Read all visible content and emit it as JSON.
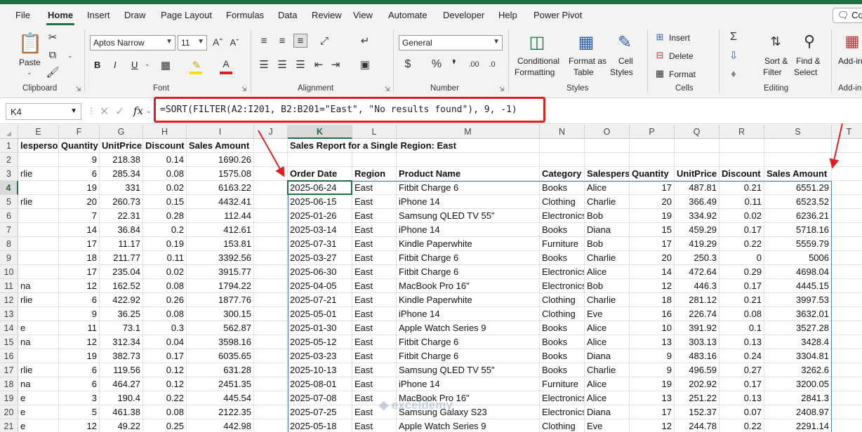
{
  "tabs": [
    "File",
    "Home",
    "Insert",
    "Draw",
    "Page Layout",
    "Formulas",
    "Data",
    "Review",
    "View",
    "Automate",
    "Developer",
    "Help",
    "Power Pivot"
  ],
  "active_tab": "Home",
  "comments_label": "Con",
  "ribbon": {
    "clipboard": {
      "label": "Clipboard",
      "paste": "Paste"
    },
    "font": {
      "label": "Font",
      "name": "Aptos Narrow",
      "size": "11",
      "bold": "B",
      "italic": "I",
      "underline": "U"
    },
    "alignment": {
      "label": "Alignment"
    },
    "number": {
      "label": "Number",
      "format": "General"
    },
    "styles": {
      "label": "Styles",
      "conditional": [
        "Conditional",
        "Formatting"
      ],
      "format_table": [
        "Format as",
        "Table"
      ],
      "cell_styles": [
        "Cell",
        "Styles"
      ]
    },
    "cells": {
      "label": "Cells",
      "insert": "Insert",
      "delete": "Delete",
      "format": "Format"
    },
    "editing": {
      "label": "Editing",
      "sort": [
        "Sort &",
        "Filter"
      ],
      "find": [
        "Find &",
        "Select"
      ]
    },
    "addins": {
      "label": "Add-in",
      "label2": "Add-ins"
    }
  },
  "formula_bar": {
    "name_box": "K4",
    "fx": "fx",
    "formula": "=SORT(FILTER(A2:I201, B2:B201=\"East\", \"No results found\"), 9, -1)"
  },
  "grid": {
    "columns": [
      "E",
      "F",
      "G",
      "H",
      "I",
      "J",
      "K",
      "L",
      "M",
      "N",
      "O",
      "P",
      "Q",
      "R",
      "S",
      "T"
    ],
    "selected_column": "K",
    "rows": [
      "1",
      "2",
      "3",
      "4",
      "5",
      "6",
      "7",
      "8",
      "9",
      "10",
      "11",
      "12",
      "13",
      "14",
      "15",
      "16",
      "17",
      "18",
      "19",
      "20",
      "21"
    ],
    "selected_row": "4",
    "left_headers": [
      "lesperson",
      "Quantity",
      "UnitPrice",
      "Discount",
      "Sales Amount"
    ],
    "left_rows": [
      [
        "",
        "9",
        "218.38",
        "0.14",
        "1690.26"
      ],
      [
        "rlie",
        "6",
        "285.34",
        "0.08",
        "1575.08"
      ],
      [
        "",
        "19",
        "331",
        "0.02",
        "6163.22"
      ],
      [
        "rlie",
        "20",
        "260.73",
        "0.15",
        "4432.41"
      ],
      [
        "",
        "7",
        "22.31",
        "0.28",
        "112.44"
      ],
      [
        "",
        "14",
        "36.84",
        "0.2",
        "412.61"
      ],
      [
        "",
        "17",
        "11.17",
        "0.19",
        "153.81"
      ],
      [
        "",
        "18",
        "211.77",
        "0.11",
        "3392.56"
      ],
      [
        "",
        "17",
        "235.04",
        "0.02",
        "3915.77"
      ],
      [
        "na",
        "12",
        "162.52",
        "0.08",
        "1794.22"
      ],
      [
        "rlie",
        "6",
        "422.92",
        "0.26",
        "1877.76"
      ],
      [
        "",
        "9",
        "36.25",
        "0.08",
        "300.15"
      ],
      [
        "e",
        "11",
        "73.1",
        "0.3",
        "562.87"
      ],
      [
        "na",
        "12",
        "312.34",
        "0.04",
        "3598.16"
      ],
      [
        "",
        "19",
        "382.73",
        "0.17",
        "6035.65"
      ],
      [
        "rlie",
        "6",
        "119.56",
        "0.12",
        "631.28"
      ],
      [
        "na",
        "6",
        "464.27",
        "0.12",
        "2451.35"
      ],
      [
        "e",
        "3",
        "190.4",
        "0.22",
        "445.54"
      ],
      [
        "e",
        "5",
        "461.38",
        "0.08",
        "2122.35"
      ],
      [
        "e",
        "12",
        "49.22",
        "0.25",
        "442.98"
      ]
    ],
    "report_title": "Sales Report for a Single Region: East",
    "report_headers": [
      "Order Date",
      "Region",
      "Product Name",
      "Category",
      "Salesperson",
      "Quantity",
      "UnitPrice",
      "Discount",
      "Sales Amount"
    ],
    "report_rows": [
      [
        "2025-06-24",
        "East",
        "Fitbit Charge 6",
        "Books",
        "Alice",
        "17",
        "487.81",
        "0.21",
        "6551.29"
      ],
      [
        "2025-06-15",
        "East",
        "iPhone 14",
        "Clothing",
        "Charlie",
        "20",
        "366.49",
        "0.11",
        "6523.52"
      ],
      [
        "2025-01-26",
        "East",
        "Samsung QLED TV 55\"",
        "Electronics",
        "Bob",
        "19",
        "334.92",
        "0.02",
        "6236.21"
      ],
      [
        "2025-03-14",
        "East",
        "iPhone 14",
        "Books",
        "Diana",
        "15",
        "459.29",
        "0.17",
        "5718.16"
      ],
      [
        "2025-07-31",
        "East",
        "Kindle Paperwhite",
        "Furniture",
        "Bob",
        "17",
        "419.29",
        "0.22",
        "5559.79"
      ],
      [
        "2025-03-27",
        "East",
        "Fitbit Charge 6",
        "Books",
        "Charlie",
        "20",
        "250.3",
        "0",
        "5006"
      ],
      [
        "2025-06-30",
        "East",
        "Fitbit Charge 6",
        "Electronics",
        "Alice",
        "14",
        "472.64",
        "0.29",
        "4698.04"
      ],
      [
        "2025-04-05",
        "East",
        "MacBook Pro 16\"",
        "Electronics",
        "Bob",
        "12",
        "446.3",
        "0.17",
        "4445.15"
      ],
      [
        "2025-07-21",
        "East",
        "Kindle Paperwhite",
        "Clothing",
        "Charlie",
        "18",
        "281.12",
        "0.21",
        "3997.53"
      ],
      [
        "2025-05-01",
        "East",
        "iPhone 14",
        "Clothing",
        "Eve",
        "16",
        "226.74",
        "0.08",
        "3632.01"
      ],
      [
        "2025-01-30",
        "East",
        "Apple Watch Series 9",
        "Books",
        "Alice",
        "10",
        "391.92",
        "0.1",
        "3527.28"
      ],
      [
        "2025-05-12",
        "East",
        "Fitbit Charge 6",
        "Books",
        "Alice",
        "13",
        "303.13",
        "0.13",
        "3428.4"
      ],
      [
        "2025-03-23",
        "East",
        "Fitbit Charge 6",
        "Books",
        "Diana",
        "9",
        "483.16",
        "0.24",
        "3304.81"
      ],
      [
        "2025-10-13",
        "East",
        "Samsung QLED TV 55\"",
        "Books",
        "Charlie",
        "9",
        "496.59",
        "0.27",
        "3262.6"
      ],
      [
        "2025-08-01",
        "East",
        "iPhone 14",
        "Furniture",
        "Alice",
        "19",
        "202.92",
        "0.17",
        "3200.05"
      ],
      [
        "2025-07-08",
        "East",
        "MacBook Pro 16\"",
        "Electronics",
        "Alice",
        "13",
        "251.22",
        "0.13",
        "2841.3"
      ],
      [
        "2025-07-25",
        "East",
        "Samsung Galaxy S23",
        "Electronics",
        "Diana",
        "17",
        "152.37",
        "0.07",
        "2408.97"
      ],
      [
        "2025-05-18",
        "East",
        "Apple Watch Series 9",
        "Clothing",
        "Eve",
        "12",
        "244.78",
        "0.22",
        "2291.14"
      ]
    ]
  },
  "watermark": "exceldemy",
  "colors": {
    "accent": "#1e7145",
    "highlight": "#e02020",
    "spill": "#4a7ed8"
  }
}
